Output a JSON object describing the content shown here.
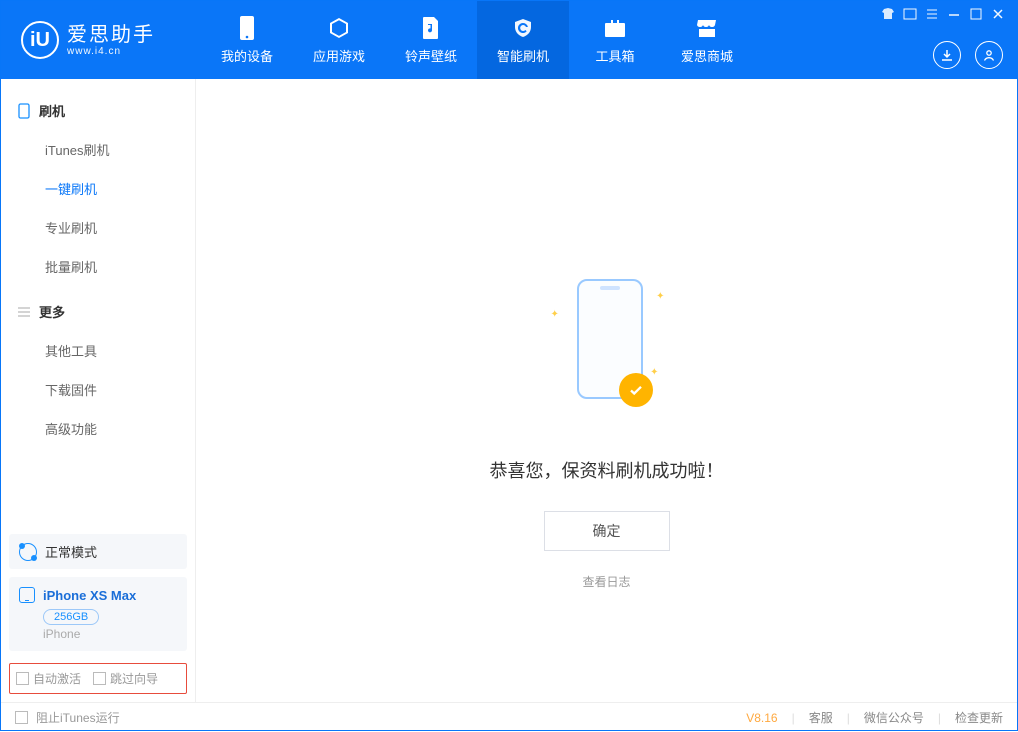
{
  "brand": {
    "name": "爱思助手",
    "url": "www.i4.cn",
    "logo_letter": "iU"
  },
  "tabs": [
    {
      "id": "device",
      "label": "我的设备"
    },
    {
      "id": "apps",
      "label": "应用游戏"
    },
    {
      "id": "media",
      "label": "铃声壁纸"
    },
    {
      "id": "flash",
      "label": "智能刷机"
    },
    {
      "id": "toolbox",
      "label": "工具箱"
    },
    {
      "id": "store",
      "label": "爱思商城"
    }
  ],
  "sidebar": {
    "section1_title": "刷机",
    "section1_items": [
      {
        "label": "iTunes刷机"
      },
      {
        "label": "一键刷机",
        "active": true
      },
      {
        "label": "专业刷机"
      },
      {
        "label": "批量刷机"
      }
    ],
    "section2_title": "更多",
    "section2_items": [
      {
        "label": "其他工具"
      },
      {
        "label": "下载固件"
      },
      {
        "label": "高级功能"
      }
    ]
  },
  "mode": {
    "label": "正常模式"
  },
  "device": {
    "name": "iPhone XS Max",
    "capacity": "256GB",
    "type": "iPhone"
  },
  "options": {
    "auto_activate": "自动激活",
    "skip_guide": "跳过向导"
  },
  "main": {
    "success_msg": "恭喜您，保资料刷机成功啦！",
    "ok_label": "确定",
    "log_link": "查看日志"
  },
  "footer": {
    "block_itunes": "阻止iTunes运行",
    "version": "V8.16",
    "support": "客服",
    "wechat": "微信公众号",
    "update": "检查更新"
  }
}
